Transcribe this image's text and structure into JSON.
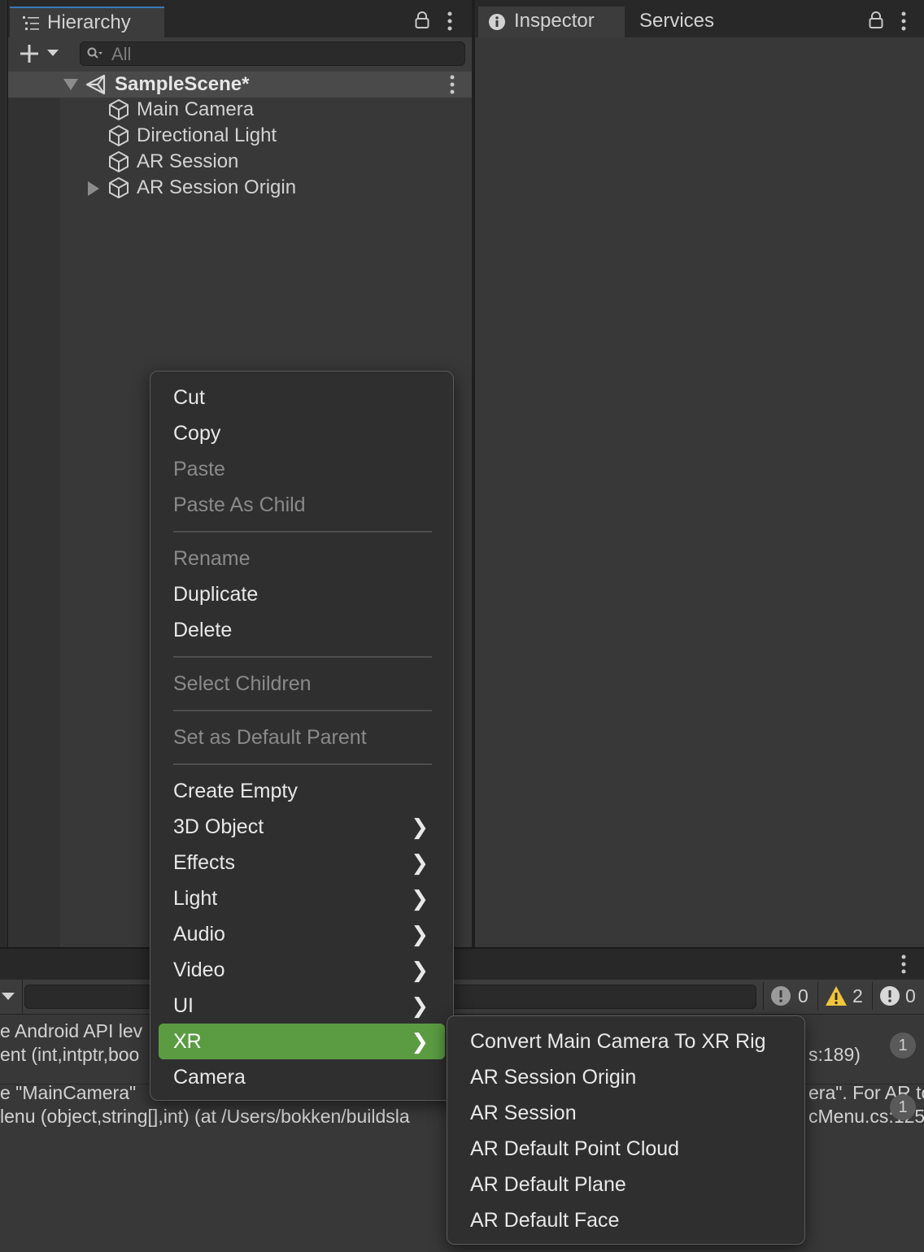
{
  "hierarchy": {
    "tab_label": "Hierarchy",
    "search_placeholder": "All",
    "scene_name": "SampleScene*",
    "items": [
      {
        "label": "Main Camera"
      },
      {
        "label": "Directional Light"
      },
      {
        "label": "AR Session"
      },
      {
        "label": "AR Session Origin"
      }
    ]
  },
  "inspector": {
    "tabs": [
      {
        "label": "Inspector"
      },
      {
        "label": "Services"
      }
    ]
  },
  "console": {
    "counts": {
      "info": "0",
      "warnings": "2",
      "errors": "0"
    },
    "lines": [
      {
        "left": "e Android API lev",
        "right": ""
      },
      {
        "left": "ent (int,intptr,boo",
        "right": "s:189)"
      },
      {
        "left": "e \"MainCamera\"",
        "right": "era\". For AR to"
      },
      {
        "left": "lenu (object,string[],int) (at /Users/bokken/buildsla",
        "right": "cMenu.cs:125"
      }
    ],
    "badges": [
      "1",
      "1"
    ]
  },
  "context_menu": {
    "groups": [
      [
        {
          "label": "Cut",
          "enabled": true
        },
        {
          "label": "Copy",
          "enabled": true
        },
        {
          "label": "Paste",
          "enabled": false
        },
        {
          "label": "Paste As Child",
          "enabled": false
        }
      ],
      [
        {
          "label": "Rename",
          "enabled": false
        },
        {
          "label": "Duplicate",
          "enabled": true
        },
        {
          "label": "Delete",
          "enabled": true
        }
      ],
      [
        {
          "label": "Select Children",
          "enabled": false
        }
      ],
      [
        {
          "label": "Set as Default Parent",
          "enabled": false
        }
      ],
      [
        {
          "label": "Create Empty",
          "enabled": true
        },
        {
          "label": "3D Object",
          "enabled": true,
          "submenu": true
        },
        {
          "label": "Effects",
          "enabled": true,
          "submenu": true
        },
        {
          "label": "Light",
          "enabled": true,
          "submenu": true
        },
        {
          "label": "Audio",
          "enabled": true,
          "submenu": true
        },
        {
          "label": "Video",
          "enabled": true,
          "submenu": true
        },
        {
          "label": "UI",
          "enabled": true,
          "submenu": true
        },
        {
          "label": "XR",
          "enabled": true,
          "submenu": true,
          "highlighted": true
        },
        {
          "label": "Camera",
          "enabled": true
        }
      ]
    ]
  },
  "xr_submenu": {
    "items": [
      {
        "label": "Convert Main Camera To XR Rig"
      },
      {
        "label": "AR Session Origin"
      },
      {
        "label": "AR Session"
      },
      {
        "label": "AR Default Point Cloud"
      },
      {
        "label": "AR Default Plane"
      },
      {
        "label": "AR Default Face"
      }
    ]
  },
  "colors": {
    "highlight": "#5b9c42",
    "tab_accent": "#3a79bb",
    "warning": "#f0c43c"
  }
}
